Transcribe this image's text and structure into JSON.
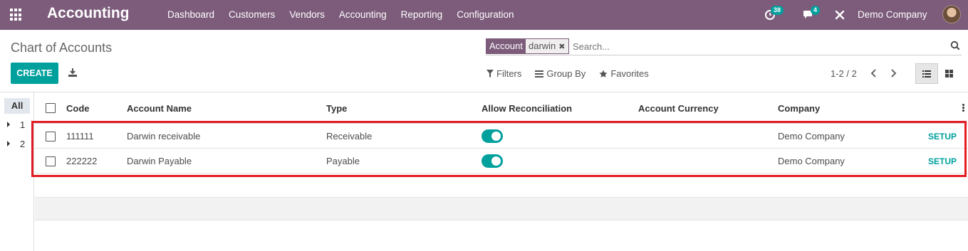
{
  "navbar": {
    "app_title": "Accounting",
    "menu": [
      "Dashboard",
      "Customers",
      "Vendors",
      "Accounting",
      "Reporting",
      "Configuration"
    ],
    "activity_count": "38",
    "message_count": "4",
    "company": "Demo Company",
    "color": "#7c5b7b"
  },
  "control_panel": {
    "title": "Chart of Accounts",
    "create_label": "CREATE",
    "search": {
      "facet_label": "Account",
      "facet_value": "darwin",
      "placeholder": "Search..."
    },
    "filters_label": "Filters",
    "groupby_label": "Group By",
    "favorites_label": "Favorites",
    "pager": "1-2 / 2"
  },
  "side_panel": {
    "all_label": "All",
    "items": [
      "1",
      "2"
    ]
  },
  "table": {
    "columns": [
      "Code",
      "Account Name",
      "Type",
      "Allow Reconciliation",
      "Account Currency",
      "Company"
    ],
    "rows": [
      {
        "code": "111111",
        "name": "Darwin receivable",
        "type": "Receivable",
        "reconcile": true,
        "currency": "",
        "company": "Demo Company",
        "action": "SETUP"
      },
      {
        "code": "222222",
        "name": "Darwin Payable",
        "type": "Payable",
        "reconcile": true,
        "currency": "",
        "company": "Demo Company",
        "action": "SETUP"
      }
    ]
  },
  "colors": {
    "accent": "#00a09d",
    "highlight": "#e31b23"
  }
}
